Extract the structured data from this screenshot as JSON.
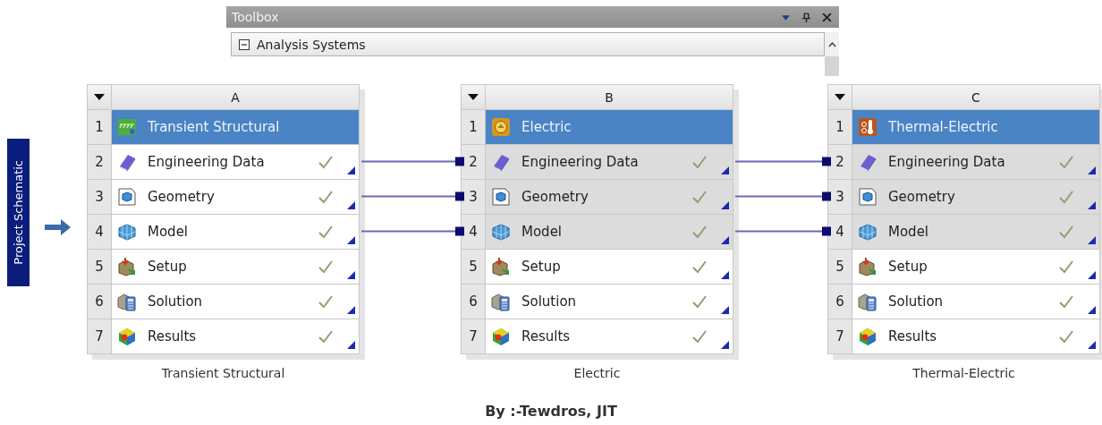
{
  "toolbox": {
    "title": "Toolbox",
    "section": {
      "label": "Analysis Systems",
      "expanded": true
    }
  },
  "side_tab": {
    "label": "Project Schematic"
  },
  "systems": [
    {
      "column": "A",
      "number": "1",
      "title": "Transient Structural",
      "kind": "structural",
      "caption": "Transient Structural",
      "cells": [
        {
          "number": "2",
          "label": "Engineering Data",
          "kind": "engineering-data",
          "complete": true,
          "linked": false
        },
        {
          "number": "3",
          "label": "Geometry",
          "kind": "geometry",
          "complete": true,
          "linked": false
        },
        {
          "number": "4",
          "label": "Model",
          "kind": "model",
          "complete": true,
          "linked": false
        },
        {
          "number": "5",
          "label": "Setup",
          "kind": "setup",
          "complete": true,
          "linked": false
        },
        {
          "number": "6",
          "label": "Solution",
          "kind": "solution",
          "complete": true,
          "linked": false
        },
        {
          "number": "7",
          "label": "Results",
          "kind": "results",
          "complete": true,
          "linked": false
        }
      ]
    },
    {
      "column": "B",
      "number": "1",
      "title": "Electric",
      "kind": "electric",
      "caption": "Electric",
      "cells": [
        {
          "number": "2",
          "label": "Engineering Data",
          "kind": "engineering-data",
          "complete": true,
          "linked": true
        },
        {
          "number": "3",
          "label": "Geometry",
          "kind": "geometry",
          "complete": true,
          "linked": true
        },
        {
          "number": "4",
          "label": "Model",
          "kind": "model",
          "complete": true,
          "linked": true
        },
        {
          "number": "5",
          "label": "Setup",
          "kind": "setup",
          "complete": true,
          "linked": false
        },
        {
          "number": "6",
          "label": "Solution",
          "kind": "solution",
          "complete": true,
          "linked": false
        },
        {
          "number": "7",
          "label": "Results",
          "kind": "results",
          "complete": true,
          "linked": false
        }
      ]
    },
    {
      "column": "C",
      "number": "1",
      "title": "Thermal-Electric",
      "kind": "thermal-electric",
      "caption": "Thermal-Electric",
      "cells": [
        {
          "number": "2",
          "label": "Engineering Data",
          "kind": "engineering-data",
          "complete": true,
          "linked": true
        },
        {
          "number": "3",
          "label": "Geometry",
          "kind": "geometry",
          "complete": true,
          "linked": true
        },
        {
          "number": "4",
          "label": "Model",
          "kind": "model",
          "complete": true,
          "linked": true
        },
        {
          "number": "5",
          "label": "Setup",
          "kind": "setup",
          "complete": true,
          "linked": false
        },
        {
          "number": "6",
          "label": "Solution",
          "kind": "solution",
          "complete": true,
          "linked": false
        },
        {
          "number": "7",
          "label": "Results",
          "kind": "results",
          "complete": true,
          "linked": false
        }
      ]
    }
  ],
  "footer": "By :-Tewdros, JIT"
}
